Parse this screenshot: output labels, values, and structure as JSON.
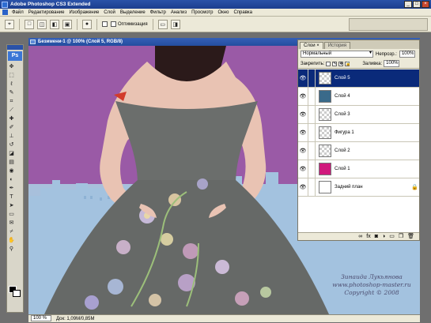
{
  "window": {
    "title": "Adobe Photoshop CS3 Extended",
    "buttons": [
      "_",
      "□",
      "×"
    ]
  },
  "menu": [
    "Файл",
    "Редактирование",
    "Изображение",
    "Слой",
    "Выделение",
    "Фильтр",
    "Анализ",
    "Просмотр",
    "Окно",
    "Справка"
  ],
  "options": {
    "auto_label": "Оптимизация"
  },
  "document": {
    "title": "Безимени-1 @ 100% (Слой 5, RGB/8)",
    "zoom": "100 %",
    "doc_info": "Док: 1,09M/0,85M"
  },
  "layers_panel": {
    "tabs": [
      "Слои ×",
      "История"
    ],
    "blend_mode": "Нормальный",
    "opacity_label": "Непрозр.:",
    "opacity": "100%",
    "lock_label": "Закрепить:",
    "fill_label": "Заливка:",
    "fill": "100%",
    "layers": [
      {
        "name": "Слой 5",
        "thumb": "checker",
        "selected": true
      },
      {
        "name": "Слой 4",
        "thumb": "blue",
        "selected": false
      },
      {
        "name": "Слой 3",
        "thumb": "checker",
        "selected": false
      },
      {
        "name": "Фигура 1",
        "thumb": "checker",
        "selected": false
      },
      {
        "name": "Слой 2",
        "thumb": "checker",
        "selected": false
      },
      {
        "name": "Слой 1",
        "thumb": "magenta",
        "selected": false
      },
      {
        "name": "Задний план",
        "thumb": "white",
        "selected": false
      }
    ],
    "footer_icons": [
      "link-icon",
      "fx-icon",
      "mask-icon",
      "adjustment-icon",
      "group-icon",
      "new-layer-icon",
      "trash-icon"
    ]
  },
  "watermark": {
    "line1": "Зинаида Лукьянова",
    "line2": "www.photoshop-master.ru",
    "line3": "Copyright © 2008"
  },
  "colors": {
    "title_bar": "#1c3e8e",
    "canvas_sky": "#9fb6d6",
    "purple": "#9a5aa6",
    "dress": "#6b6e6c",
    "selected_layer": "#0a2a7a"
  }
}
